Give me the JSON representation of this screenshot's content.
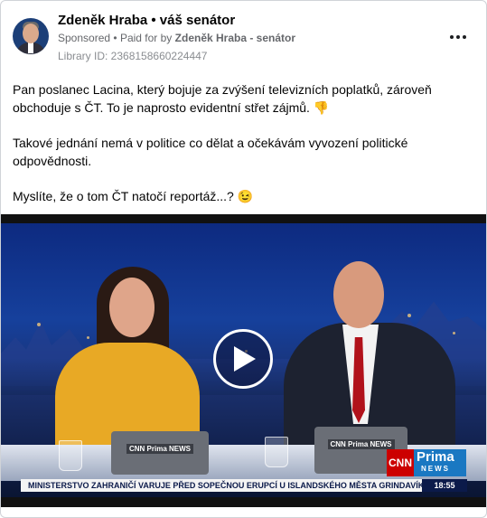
{
  "post": {
    "page_name": "Zdeněk Hraba • váš senátor",
    "sponsored_label": "Sponsored",
    "paid_for_prefix": "Paid for by",
    "paid_for_name": "Zdeněk Hraba - senátor",
    "library_id": "Library ID: 2368158660224447",
    "paragraphs": [
      "Pan poslanec Lacina, který bojuje za zvýšení televizních poplatků, zároveň obchoduje s ČT. To je naprosto evidentní střet zájmů. 👎",
      "Takové jednání nemá v politice co dělat a očekávám vyvození politické odpovědnosti.",
      "Myslíte, že o tom ČT natočí reportáž...? 😉"
    ]
  },
  "video": {
    "ticker_text": "MINISTERSTVO ZAHRANIČÍ VARUJE PŘED SOPEČNOU ERUPCÍ U ISLANDSKÉHO MĚSTA GRINDAVÍK.",
    "clock": "18:55",
    "logo_cnn": "CNN",
    "logo_prima": "Prima",
    "logo_news": "NEWS",
    "laptop_logo": "CNN Prima NEWS"
  },
  "icons": {
    "more": "more-options-icon",
    "play": "play-icon"
  },
  "colors": {
    "text_primary": "#050505",
    "text_secondary": "#65676b",
    "cnn_red": "#cc0000",
    "prima_blue": "#1a78c2"
  }
}
